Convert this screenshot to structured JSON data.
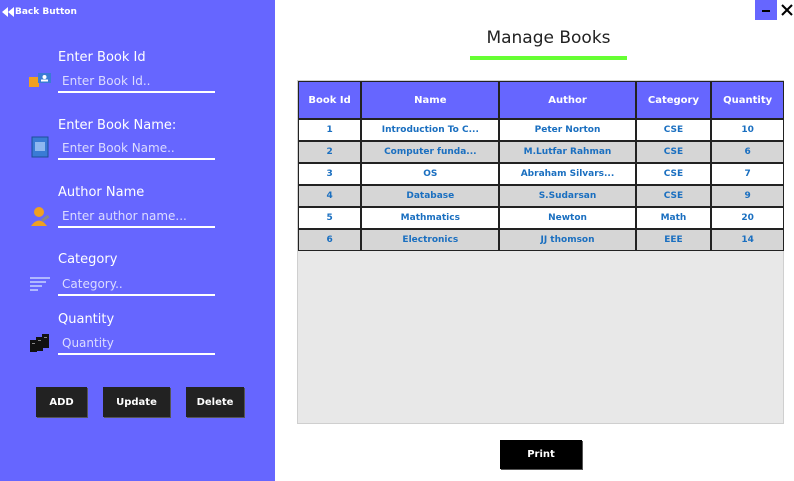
{
  "sidebar": {
    "back_label": "Back Button",
    "fields": [
      {
        "label": "Enter Book Id",
        "placeholder": "Enter Book Id..",
        "value": ""
      },
      {
        "label": "Enter Book Name:",
        "placeholder": "Enter Book Name..",
        "value": ""
      },
      {
        "label": "Author Name",
        "placeholder": "Enter author name...",
        "value": ""
      },
      {
        "label": "Category",
        "placeholder": "Category..",
        "value": ""
      },
      {
        "label": "Quantity",
        "placeholder": "Quantity",
        "value": ""
      }
    ],
    "buttons": {
      "add": "ADD",
      "update": "Update",
      "delete": "Delete"
    }
  },
  "window": {
    "minimize": "−",
    "close": "✕"
  },
  "main": {
    "title": "Manage Books",
    "table": {
      "headers": [
        "Book Id",
        "Name",
        "Author",
        "Category",
        "Quantity"
      ],
      "rows": [
        [
          "1",
          "Introduction To C...",
          "Peter Norton",
          "CSE",
          "10"
        ],
        [
          "2",
          "Computer funda...",
          "M.Lutfar Rahman",
          "CSE",
          "6"
        ],
        [
          "3",
          "OS",
          "Abraham Silvars...",
          "CSE",
          "7"
        ],
        [
          "4",
          "Database",
          "S.Sudarsan",
          "CSE",
          "9"
        ],
        [
          "5",
          "Mathmatics",
          "Newton",
          "Math",
          "20"
        ],
        [
          "6",
          "Electronics",
          "JJ thomson",
          "EEE",
          "14"
        ]
      ]
    },
    "print_label": "Print"
  },
  "colors": {
    "sidebar_bg": "#6666ff",
    "accent_line": "#66ff33",
    "header_bg": "#6666ff",
    "cell_text": "#1a6fc0"
  }
}
